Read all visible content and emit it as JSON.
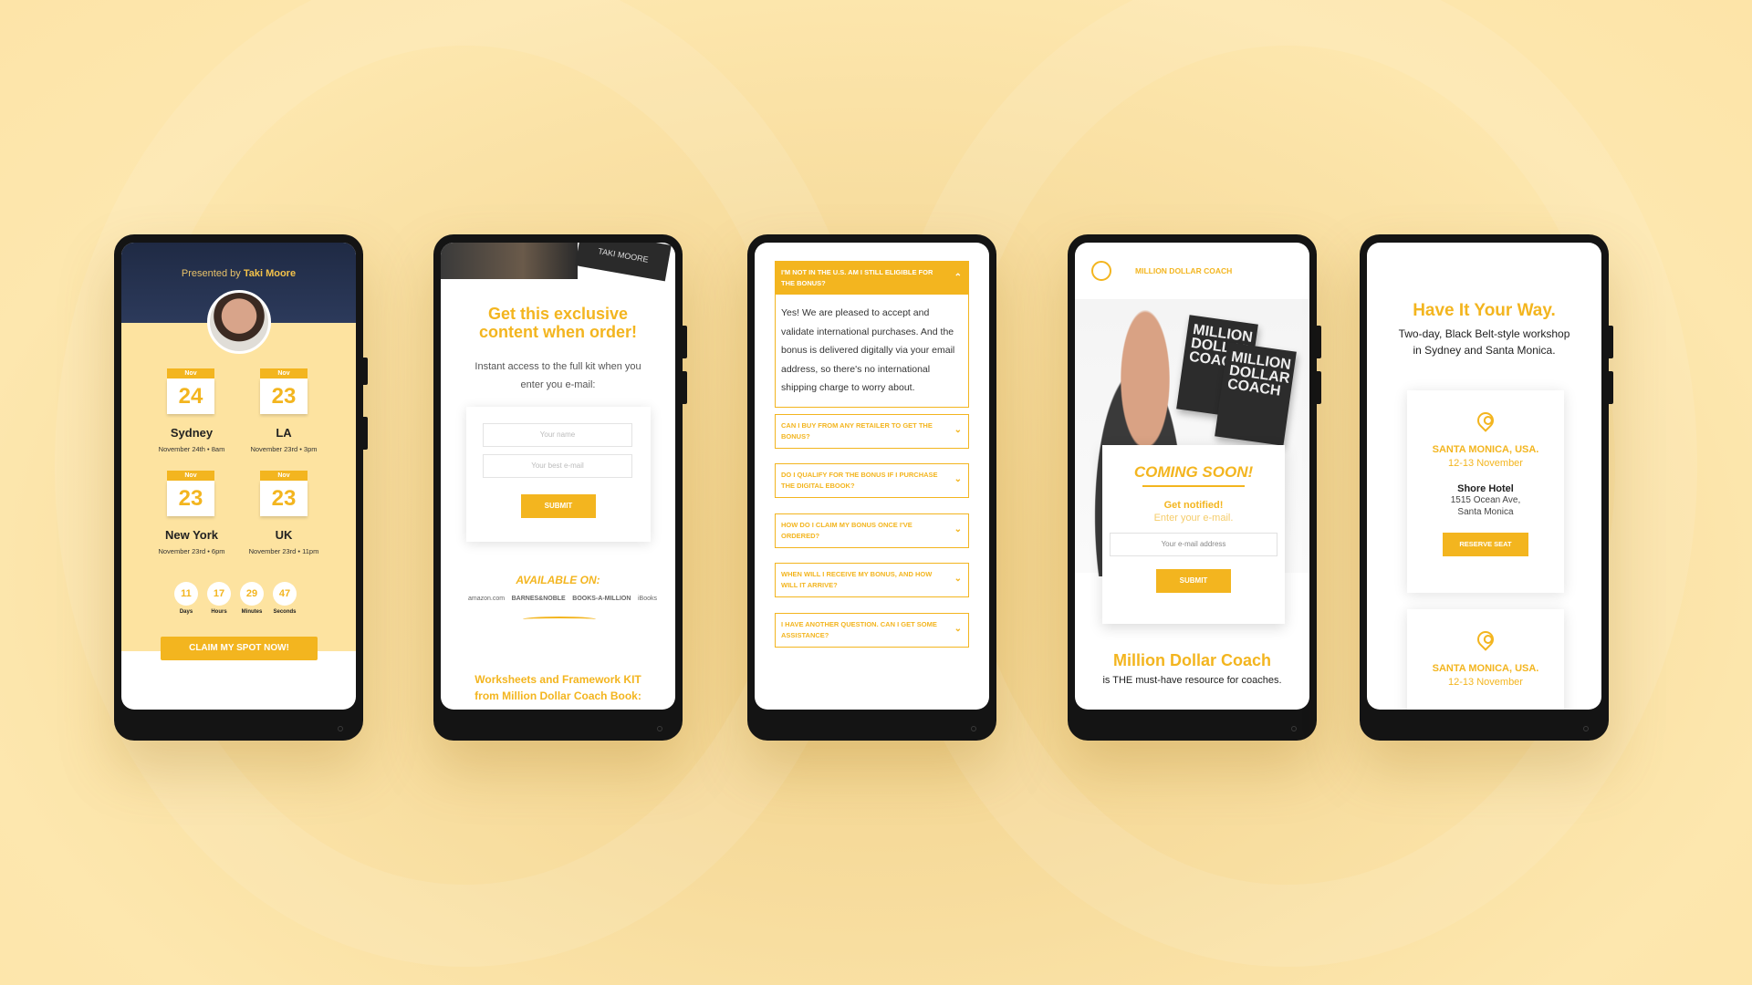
{
  "phone1": {
    "presented_prefix": "Presented by",
    "presenter": "Taki Moore",
    "events": [
      {
        "month": "Nov",
        "day": "24",
        "city": "Sydney",
        "when": "November 24th • 8am"
      },
      {
        "month": "Nov",
        "day": "23",
        "city": "LA",
        "when": "November 23rd • 3pm"
      },
      {
        "month": "Nov",
        "day": "23",
        "city": "New York",
        "when": "November 23rd • 6pm"
      },
      {
        "month": "Nov",
        "day": "23",
        "city": "UK",
        "when": "November 23rd • 11pm"
      }
    ],
    "countdown": [
      {
        "value": "11",
        "label": "Days"
      },
      {
        "value": "17",
        "label": "Hours"
      },
      {
        "value": "29",
        "label": "Minutes"
      },
      {
        "value": "47",
        "label": "Seconds"
      }
    ],
    "cta": "CLAIM MY SPOT NOW!"
  },
  "phone2": {
    "book_tag": "TAKI MOORE",
    "title_line1": "Get this exclusive",
    "title_line2": "content when order!",
    "subtitle_line1": "Instant access to the full kit when you",
    "subtitle_line2": "enter you e-mail:",
    "name_placeholder": "Your name",
    "email_placeholder": "Your best e-mail",
    "submit": "SUBMIT",
    "available_on": "AVAILABLE ON:",
    "retailers": [
      "amazon.com",
      "BARNES&NOBLE",
      "BOOKS-A-MILLION",
      "iBooks"
    ],
    "footer_line1": "Worksheets and Framework KIT",
    "footer_line2": "from  Million Dollar Coach Book:"
  },
  "phone3": {
    "open_question": "I'M NOT IN THE U.S. AM I STILL ELIGIBLE FOR THE BONUS?",
    "open_answer": "Yes! We are pleased to accept and validate international purchases.  And the bonus is delivered digitally via your email address, so there's no international shipping charge to worry about.",
    "questions": [
      "CAN I BUY FROM ANY RETAILER TO GET THE BONUS?",
      "DO I QUALIFY FOR THE BONUS IF I PURCHASE THE DIGITAL EBOOK?",
      "HOW DO I CLAIM MY BONUS ONCE I'VE ORDERED?",
      "WHEN WILL I RECEIVE MY BONUS, AND HOW WILL IT ARRIVE?",
      "I HAVE ANOTHER QUESTION. CAN I GET SOME ASSISTANCE?"
    ]
  },
  "phone4": {
    "brand": "MILLION DOLLAR COACH",
    "book_title": "MILLION DOLLAR COACH",
    "coming_soon": "COMING SOON!",
    "get_notified": "Get notified!",
    "enter_email": "Enter your e-mail.",
    "email_placeholder": "Your e-mail address",
    "submit": "SUBMIT",
    "headline": "Million Dollar Coach",
    "tagline": "is THE must-have resource for coaches."
  },
  "phone5": {
    "title": "Have It Your Way.",
    "subtitle_line1": "Two-day, Black Belt-style workshop",
    "subtitle_line2": "in Sydney and Santa Monica.",
    "venues": [
      {
        "location": "SANTA MONICA, USA.",
        "dates": "12-13 November",
        "hotel": "Shore Hotel",
        "address": "1515 Ocean Ave, Santa Monica",
        "button": "RESERVE SEAT"
      },
      {
        "location": "SANTA MONICA, USA.",
        "dates": "12-13 November"
      }
    ]
  },
  "colors": {
    "accent": "#f3b51f",
    "background": "#fde4a8",
    "phone": "#141414",
    "navy": "#1f2a44"
  }
}
